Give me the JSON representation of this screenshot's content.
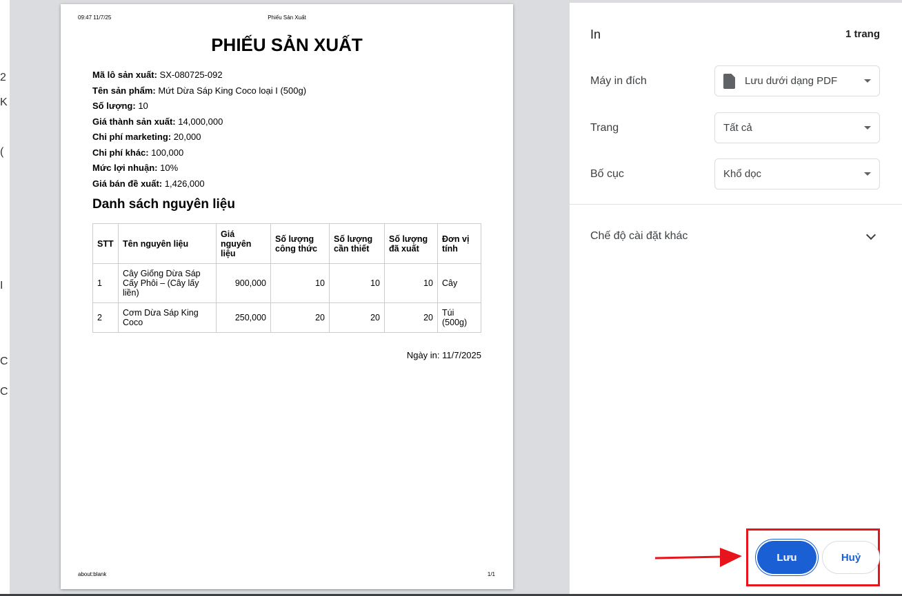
{
  "backdrop": {
    "glyphs": [
      "2",
      "K",
      "(",
      "I",
      "C",
      "C"
    ]
  },
  "preview": {
    "header_time": "09:47 11/7/25",
    "header_title": "Phiếu Sản Xuất",
    "title": "PHIẾU SẢN XUẤT",
    "fields": [
      {
        "label": "Mã lô sản xuất:",
        "value": "SX-080725-092"
      },
      {
        "label": "Tên sản phẩm:",
        "value": "Mứt Dừa Sáp King Coco loại I (500g)"
      },
      {
        "label": "Số lượng:",
        "value": "10"
      },
      {
        "label": "Giá thành sản xuất:",
        "value": "14,000,000"
      },
      {
        "label": "Chi phí marketing:",
        "value": "20,000"
      },
      {
        "label": "Chi phí khác:",
        "value": "100,000"
      },
      {
        "label": "Mức lợi nhuận:",
        "value": "10%"
      },
      {
        "label": "Giá bán đề xuất:",
        "value": "1,426,000"
      }
    ],
    "section_title": "Danh sách nguyên liệu",
    "table": {
      "headers": [
        "STT",
        "Tên nguyên liệu",
        "Giá nguyên liệu",
        "Số lượng công thức",
        "Số lượng cần thiết",
        "Số lượng đã xuất",
        "Đơn vị tính"
      ],
      "rows": [
        [
          "1",
          "Cây Giống Dừa Sáp Cấy Phôi – (Cây lấy liền)",
          "900,000",
          "10",
          "10",
          "10",
          "Cây"
        ],
        [
          "2",
          "Cơm Dừa Sáp King Coco",
          "250,000",
          "20",
          "20",
          "20",
          "Túi (500g)"
        ]
      ]
    },
    "print_date": "Ngày in: 11/7/2025",
    "footer_url": "about:blank",
    "footer_page": "1/1"
  },
  "panel": {
    "title": "In",
    "page_count": "1 trang",
    "destination_label": "Máy in đích",
    "destination_value": "Lưu dưới dạng PDF",
    "pages_label": "Trang",
    "pages_value": "Tất cả",
    "layout_label": "Bố cục",
    "layout_value": "Khổ dọc",
    "more_settings": "Chế độ cài đặt khác",
    "save_label": "Lưu",
    "cancel_label": "Huỷ"
  },
  "colors": {
    "accent": "#1a5fd4",
    "highlight": "#e8141b"
  }
}
